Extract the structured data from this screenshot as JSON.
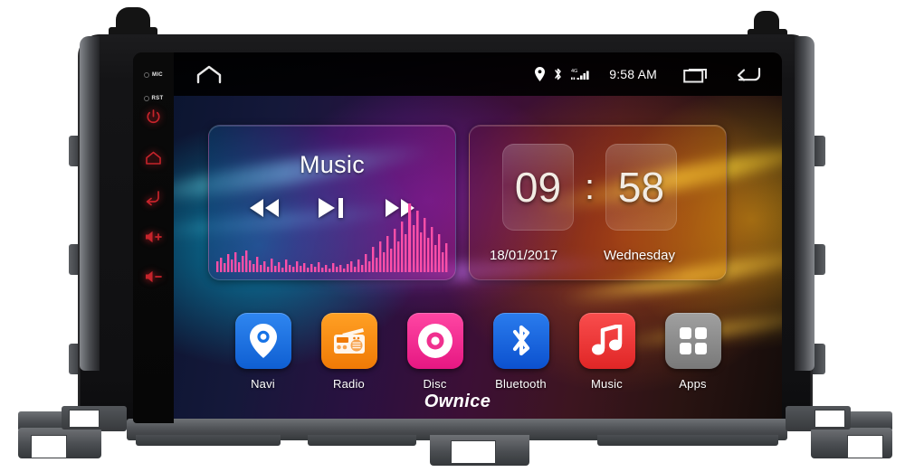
{
  "device": {
    "brand": "Ownice",
    "bezel_buttons": [
      {
        "name": "MIC",
        "label": "MIC",
        "type": "pinhole"
      },
      {
        "name": "RST",
        "label": "RST",
        "type": "pinhole"
      },
      {
        "name": "power",
        "label": "",
        "type": "icon"
      },
      {
        "name": "home",
        "label": "",
        "type": "icon"
      },
      {
        "name": "back",
        "label": "",
        "type": "icon"
      },
      {
        "name": "volume-up",
        "label": "+",
        "type": "icon"
      },
      {
        "name": "volume-down",
        "label": "-",
        "type": "icon"
      }
    ]
  },
  "statusbar": {
    "home_icon": "home-icon",
    "time": "9:58 AM",
    "icons": [
      "location-pin-icon",
      "bluetooth-icon",
      "signal-4g-icon"
    ],
    "network_label": "4G",
    "recents_icon": "recents-icon",
    "back_icon": "back-icon"
  },
  "widgets": {
    "music": {
      "title": "Music",
      "prev_label": "previous-track",
      "playpause_label": "play-pause",
      "next_label": "next-track"
    },
    "clock": {
      "hours": "09",
      "separator": ":",
      "minutes": "58",
      "date": "18/01/2017",
      "weekday": "Wednesday"
    }
  },
  "dock": {
    "apps": [
      {
        "label": "Navi",
        "icon": "navi-pin-icon",
        "color": "#1673e6"
      },
      {
        "label": "Radio",
        "icon": "radio-icon",
        "color": "#f68a12"
      },
      {
        "label": "Disc",
        "icon": "disc-icon",
        "color": "#f0308f"
      },
      {
        "label": "Bluetooth",
        "icon": "bluetooth-icon",
        "color": "#1160df"
      },
      {
        "label": "Music",
        "icon": "music-note-icon",
        "color": "#ec3b3b"
      },
      {
        "label": "Apps",
        "icon": "apps-grid-icon",
        "color": "#8b8b8b"
      }
    ]
  },
  "colors": {
    "accent_red": "#c6242b",
    "screen_black": "#000000",
    "chassis": "#141416",
    "mount_gray": "#5c5f63"
  }
}
